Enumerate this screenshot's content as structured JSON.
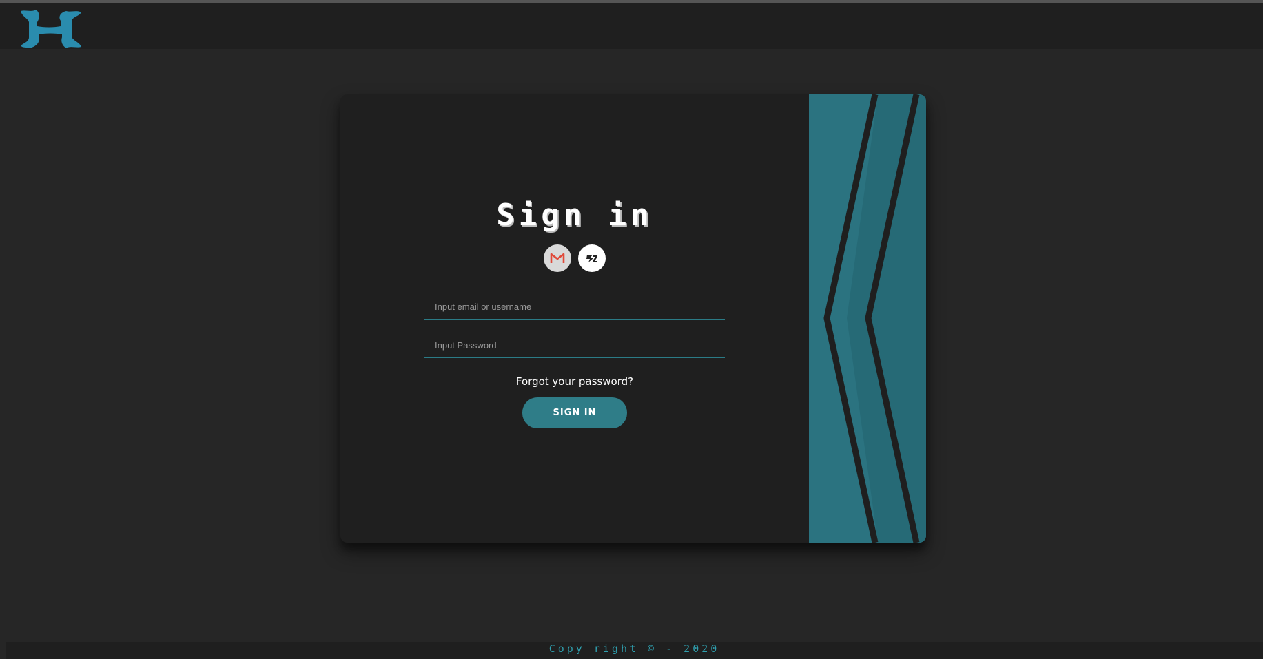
{
  "header": {
    "logo_icon": "h-logo-icon",
    "logo_color": "#2a8cae"
  },
  "signin": {
    "title": "Sign in",
    "social": [
      {
        "icon": "gmail-icon"
      },
      {
        "icon": "alt-login-icon"
      }
    ],
    "email_placeholder": "Input email or username",
    "password_placeholder": "Input Password",
    "forgot_label": "Forgot your password?",
    "button_label": "SIGN IN",
    "accent_color": "#2f7d88"
  },
  "footer": {
    "text": "Copy right © - 2020"
  }
}
